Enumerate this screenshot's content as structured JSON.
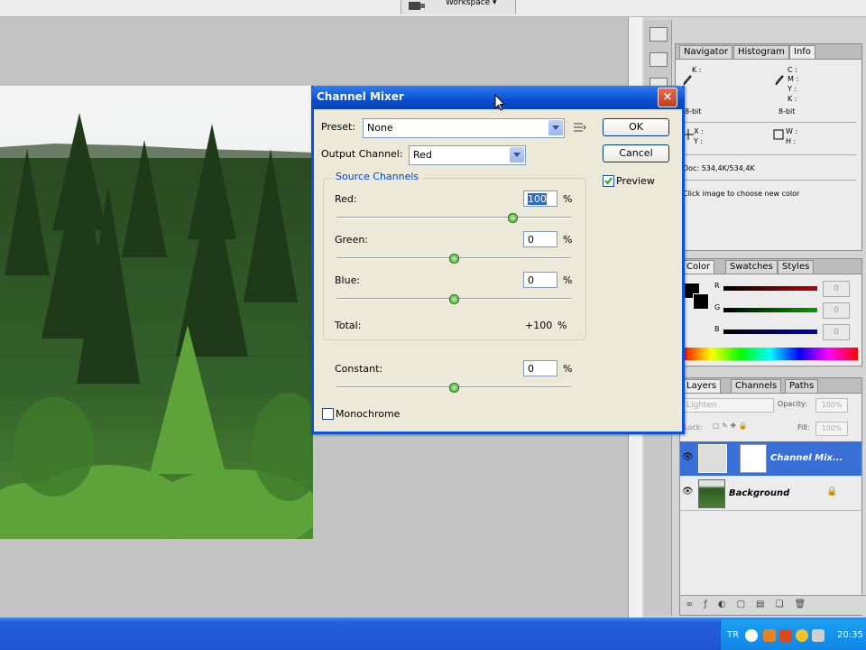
{
  "topbar": {
    "workspace_label": "Workspace ▾"
  },
  "info_panel": {
    "tabs": [
      "Navigator",
      "Histogram",
      "Info"
    ],
    "rows": {
      "k1": "K :",
      "c": "C :",
      "m": "M :",
      "y": "Y :",
      "k2": "K :",
      "bit1": "8-bit",
      "bit2": "8-bit",
      "x": "X :",
      "ycoord": "Y :",
      "w": "W :",
      "h": "H :"
    },
    "doc": "Doc: 534,4K/534,4K",
    "hint": "Click image to choose new color"
  },
  "color_panel": {
    "tabs": [
      "Color",
      "Swatches",
      "Styles"
    ],
    "channels": [
      {
        "label": "R",
        "value": "0"
      },
      {
        "label": "G",
        "value": "0"
      },
      {
        "label": "B",
        "value": "0"
      }
    ],
    "colors": {
      "r": "#c00000",
      "g": "#00a000",
      "b": "#0000c0"
    }
  },
  "layers_panel": {
    "tabs": [
      "Layers",
      "Channels",
      "Paths"
    ],
    "blend_mode": "Lighten",
    "opacity_label": "Opacity:",
    "opacity_value": "100%",
    "lock_label": "Lock:",
    "fill_label": "Fill:",
    "fill_value": "100%",
    "layers": [
      {
        "name": "Channel Mix..."
      },
      {
        "name": "Background"
      }
    ]
  },
  "dialog": {
    "title": "Channel Mixer",
    "close": "×",
    "preset_label": "Preset:",
    "preset_value": "None",
    "output_label": "Output Channel:",
    "output_value": "Red",
    "ok": "OK",
    "cancel": "Cancel",
    "preview_label": "Preview",
    "preview_checked": true,
    "source_title": "Source Channels",
    "channels": [
      {
        "label": "Red:",
        "value": "100",
        "unit": "%",
        "level": 100
      },
      {
        "label": "Green:",
        "value": "0",
        "unit": "%",
        "level": 0
      },
      {
        "label": "Blue:",
        "value": "0",
        "unit": "%",
        "level": 0
      }
    ],
    "total_label": "Total:",
    "total_value": "+100",
    "total_unit": "%",
    "constant_label": "Constant:",
    "constant_value": "0",
    "constant_unit": "%",
    "monochrome_label": "Monochrome",
    "monochrome_checked": false
  },
  "taskbar": {
    "lang": "TR",
    "clock": "20:35"
  }
}
